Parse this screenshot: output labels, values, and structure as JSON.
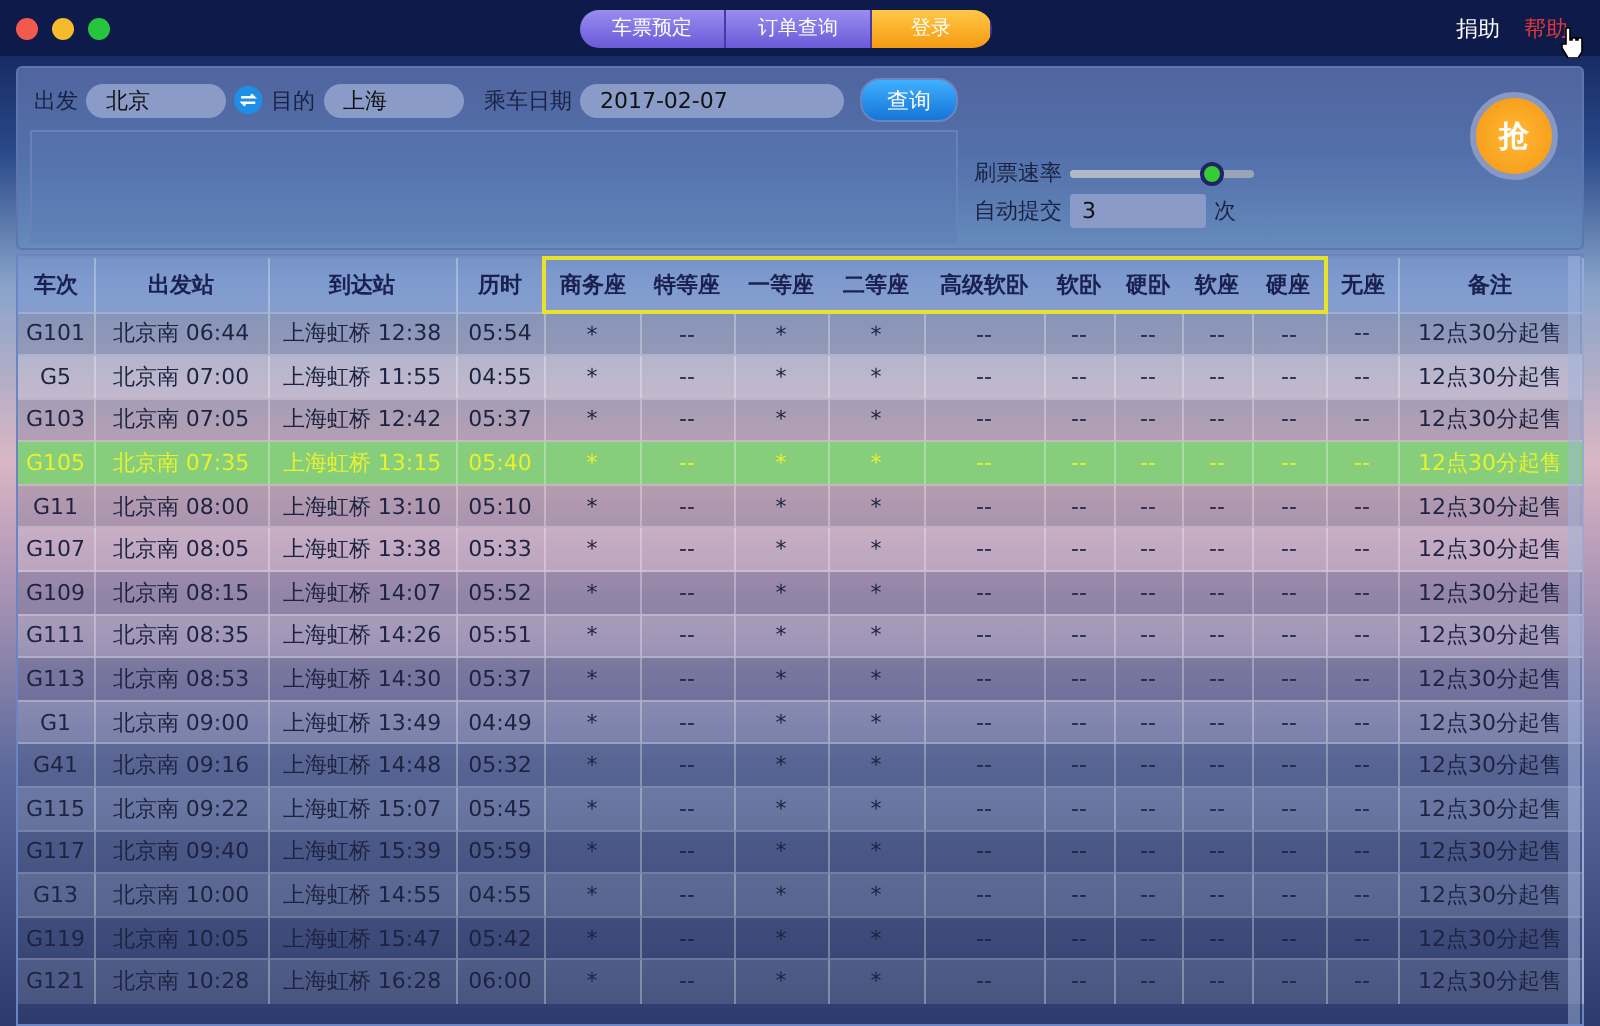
{
  "tabs": [
    {
      "label": "车票预定",
      "selected": false
    },
    {
      "label": "订单查询",
      "selected": false
    },
    {
      "label": "登录",
      "selected": true
    }
  ],
  "top_links": [
    {
      "label": "捐助",
      "kind": "plain"
    },
    {
      "label": "帮助",
      "kind": "hover"
    }
  ],
  "search": {
    "from_label": "出发",
    "from": "北京",
    "to_label": "目的",
    "to": "上海",
    "date_label": "乘车日期",
    "date": "2017-02-07",
    "query_button": "查询"
  },
  "options": {
    "speed_label": "刷票速率",
    "speed": {
      "level": 0.77
    },
    "auto_label": "自动提交",
    "auto_count": "3",
    "auto_unit": "次"
  },
  "grab_button": "抢",
  "table": {
    "columns": [
      {
        "label": "车次",
        "highlighted": false
      },
      {
        "label": "出发站",
        "highlighted": false
      },
      {
        "label": "到达站",
        "highlighted": false
      },
      {
        "label": "历时",
        "highlighted": false
      },
      {
        "label": "商务座",
        "highlighted": true
      },
      {
        "label": "特等座",
        "highlighted": true
      },
      {
        "label": "一等座",
        "highlighted": true
      },
      {
        "label": "二等座",
        "highlighted": true
      },
      {
        "label": "高级软卧",
        "highlighted": true
      },
      {
        "label": "软卧",
        "highlighted": true
      },
      {
        "label": "硬卧",
        "highlighted": true
      },
      {
        "label": "软座",
        "highlighted": true
      },
      {
        "label": "硬座",
        "highlighted": true
      },
      {
        "label": "无座",
        "highlighted": false
      },
      {
        "label": "备注",
        "highlighted": false
      }
    ],
    "rows": [
      {
        "selected": false,
        "cells": [
          "G101",
          "北京南 06:44",
          "上海虹桥 12:38",
          "05:54",
          "*",
          "--",
          "*",
          "*",
          "--",
          "--",
          "--",
          "--",
          "--",
          "--",
          "12点30分起售"
        ]
      },
      {
        "selected": false,
        "cells": [
          "G5",
          "北京南 07:00",
          "上海虹桥 11:55",
          "04:55",
          "*",
          "--",
          "*",
          "*",
          "--",
          "--",
          "--",
          "--",
          "--",
          "--",
          "12点30分起售"
        ]
      },
      {
        "selected": false,
        "cells": [
          "G103",
          "北京南 07:05",
          "上海虹桥 12:42",
          "05:37",
          "*",
          "--",
          "*",
          "*",
          "--",
          "--",
          "--",
          "--",
          "--",
          "--",
          "12点30分起售"
        ]
      },
      {
        "selected": true,
        "cells": [
          "G105",
          "北京南 07:35",
          "上海虹桥 13:15",
          "05:40",
          "*",
          "--",
          "*",
          "*",
          "--",
          "--",
          "--",
          "--",
          "--",
          "--",
          "12点30分起售"
        ]
      },
      {
        "selected": false,
        "cells": [
          "G11",
          "北京南 08:00",
          "上海虹桥 13:10",
          "05:10",
          "*",
          "--",
          "*",
          "*",
          "--",
          "--",
          "--",
          "--",
          "--",
          "--",
          "12点30分起售"
        ]
      },
      {
        "selected": false,
        "cells": [
          "G107",
          "北京南 08:05",
          "上海虹桥 13:38",
          "05:33",
          "*",
          "--",
          "*",
          "*",
          "--",
          "--",
          "--",
          "--",
          "--",
          "--",
          "12点30分起售"
        ]
      },
      {
        "selected": false,
        "cells": [
          "G109",
          "北京南 08:15",
          "上海虹桥 14:07",
          "05:52",
          "*",
          "--",
          "*",
          "*",
          "--",
          "--",
          "--",
          "--",
          "--",
          "--",
          "12点30分起售"
        ]
      },
      {
        "selected": false,
        "cells": [
          "G111",
          "北京南 08:35",
          "上海虹桥 14:26",
          "05:51",
          "*",
          "--",
          "*",
          "*",
          "--",
          "--",
          "--",
          "--",
          "--",
          "--",
          "12点30分起售"
        ]
      },
      {
        "selected": false,
        "cells": [
          "G113",
          "北京南 08:53",
          "上海虹桥 14:30",
          "05:37",
          "*",
          "--",
          "*",
          "*",
          "--",
          "--",
          "--",
          "--",
          "--",
          "--",
          "12点30分起售"
        ]
      },
      {
        "selected": false,
        "cells": [
          "G1",
          "北京南 09:00",
          "上海虹桥 13:49",
          "04:49",
          "*",
          "--",
          "*",
          "*",
          "--",
          "--",
          "--",
          "--",
          "--",
          "--",
          "12点30分起售"
        ]
      },
      {
        "selected": false,
        "cells": [
          "G41",
          "北京南 09:16",
          "上海虹桥 14:48",
          "05:32",
          "*",
          "--",
          "*",
          "*",
          "--",
          "--",
          "--",
          "--",
          "--",
          "--",
          "12点30分起售"
        ]
      },
      {
        "selected": false,
        "cells": [
          "G115",
          "北京南 09:22",
          "上海虹桥 15:07",
          "05:45",
          "*",
          "--",
          "*",
          "*",
          "--",
          "--",
          "--",
          "--",
          "--",
          "--",
          "12点30分起售"
        ]
      },
      {
        "selected": false,
        "cells": [
          "G117",
          "北京南 09:40",
          "上海虹桥 15:39",
          "05:59",
          "*",
          "--",
          "*",
          "*",
          "--",
          "--",
          "--",
          "--",
          "--",
          "--",
          "12点30分起售"
        ]
      },
      {
        "selected": false,
        "cells": [
          "G13",
          "北京南 10:00",
          "上海虹桥 14:55",
          "04:55",
          "*",
          "--",
          "*",
          "*",
          "--",
          "--",
          "--",
          "--",
          "--",
          "--",
          "12点30分起售"
        ]
      },
      {
        "selected": false,
        "cells": [
          "G119",
          "北京南 10:05",
          "上海虹桥 15:47",
          "05:42",
          "*",
          "--",
          "*",
          "*",
          "--",
          "--",
          "--",
          "--",
          "--",
          "--",
          "12点30分起售"
        ]
      },
      {
        "selected": false,
        "cells": [
          "G121",
          "北京南 10:28",
          "上海虹桥 16:28",
          "06:00",
          "*",
          "--",
          "*",
          "*",
          "--",
          "--",
          "--",
          "--",
          "--",
          "--",
          "12点30分起售"
        ]
      }
    ]
  }
}
